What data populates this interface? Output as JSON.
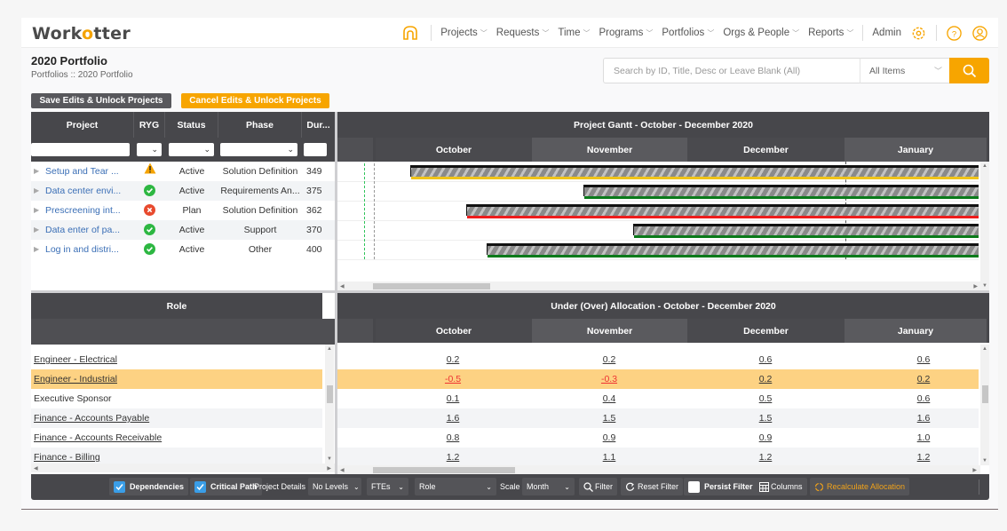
{
  "app": {
    "logo_prefix": "Work",
    "logo_o": "o",
    "logo_suffix": "tter"
  },
  "nav": {
    "items": [
      {
        "label": "Projects"
      },
      {
        "label": "Requests"
      },
      {
        "label": "Time"
      },
      {
        "label": "Programs"
      },
      {
        "label": "Portfolios"
      },
      {
        "label": "Orgs & People"
      },
      {
        "label": "Reports"
      }
    ],
    "admin_label": "Admin",
    "icons": [
      "home-icon",
      "gear-icon",
      "help-icon",
      "user-icon"
    ]
  },
  "page": {
    "title": "2020 Portfolio",
    "breadcrumb": "Portfolios :: 2020 Portfolio"
  },
  "search": {
    "placeholder": "Search by ID, Title, Desc or Leave Blank (All)",
    "scope_value": "All Items"
  },
  "actions": {
    "save_label": "Save Edits & Unlock Projects",
    "cancel_label": "Cancel Edits & Unlock Projects"
  },
  "colors": {
    "accent": "#f7a500",
    "header_dark": "#47474b",
    "ryg_green": "#2db742",
    "ryg_red": "#e84a2e",
    "ryg_yellow": "#f5a300",
    "highlight_row": "#fdd283",
    "negative": "#e33333"
  },
  "project_grid": {
    "columns": [
      "Project",
      "RYG",
      "Status",
      "Phase",
      "Dur..."
    ],
    "rows": [
      {
        "project": "Setup and Tear ...",
        "ryg": "yellow",
        "status": "Active",
        "phase": "Solution Definition",
        "duration": "349"
      },
      {
        "project": "Data center envi...",
        "ryg": "green",
        "status": "Active",
        "phase": "Requirements An...",
        "duration": "375"
      },
      {
        "project": "Prescreening int...",
        "ryg": "red",
        "status": "Plan",
        "phase": "Solution Definition",
        "duration": "362"
      },
      {
        "project": "Data enter of pa...",
        "ryg": "green",
        "status": "Active",
        "phase": "Support",
        "duration": "370"
      },
      {
        "project": "Log in and distri...",
        "ryg": "green",
        "status": "Active",
        "phase": "Other",
        "duration": "400"
      }
    ]
  },
  "gantt": {
    "title": "Project Gantt - October - December 2020",
    "months": [
      "October",
      "November",
      "December",
      "January"
    ],
    "bars": [
      {
        "project": "Setup and Tear ...",
        "start_month_offset": 0.22,
        "status_color": "#f0c419"
      },
      {
        "project": "Data center envi...",
        "start_month_offset": 1.33,
        "status_color": "#0a7a1a"
      },
      {
        "project": "Prescreening int...",
        "start_month_offset": 0.58,
        "status_color": "#ee1c1c"
      },
      {
        "project": "Data enter of pa...",
        "start_month_offset": 1.65,
        "status_color": "#0a7a1a"
      },
      {
        "project": "Log in and distri...",
        "start_month_offset": 0.71,
        "status_color": "#0a7a1a"
      }
    ]
  },
  "allocation": {
    "role_header": "Role",
    "title": "Under (Over) Allocation - October - December 2020",
    "months": [
      "October",
      "November",
      "December",
      "January"
    ],
    "rows": [
      {
        "role": "Engineer - Electrical",
        "link": true,
        "values": [
          "0.2",
          "0.2",
          "0.6",
          "0.6"
        ],
        "negative": [
          false,
          false,
          false,
          false
        ]
      },
      {
        "role": "Engineer - Industrial",
        "link": true,
        "highlight": true,
        "values": [
          "-0.5",
          "-0.3",
          "0.2",
          "0.2"
        ],
        "negative": [
          true,
          true,
          false,
          false
        ]
      },
      {
        "role": "Executive Sponsor",
        "link": false,
        "values": [
          "0.1",
          "0.4",
          "0.5",
          "0.6"
        ],
        "negative": [
          false,
          false,
          false,
          false
        ]
      },
      {
        "role": "Finance - Accounts Payable",
        "link": true,
        "values": [
          "1.6",
          "1.5",
          "1.5",
          "1.6"
        ],
        "negative": [
          false,
          false,
          false,
          false
        ]
      },
      {
        "role": "Finance - Accounts Receivable",
        "link": true,
        "values": [
          "0.8",
          "0.9",
          "0.9",
          "1.0"
        ],
        "negative": [
          false,
          false,
          false,
          false
        ]
      },
      {
        "role": "Finance - Billing",
        "link": true,
        "values": [
          "1.2",
          "1.1",
          "1.2",
          "1.2"
        ],
        "negative": [
          false,
          false,
          false,
          false
        ]
      }
    ]
  },
  "toolbar": {
    "dependencies_label": "Dependencies",
    "dependencies_checked": true,
    "critical_path_label": "Critical Path",
    "critical_path_checked": true,
    "project_details_label": "Project Details",
    "levels_value": "No Levels",
    "units_value": "FTEs",
    "group_value": "Role",
    "scale_label": "Scale",
    "scale_value": "Month",
    "filter_label": "Filter",
    "reset_filter_label": "Reset Filter",
    "persist_filter_label": "Persist Filter",
    "persist_filter_checked": false,
    "columns_label": "Columns",
    "recalculate_label": "Recalculate Allocation"
  }
}
